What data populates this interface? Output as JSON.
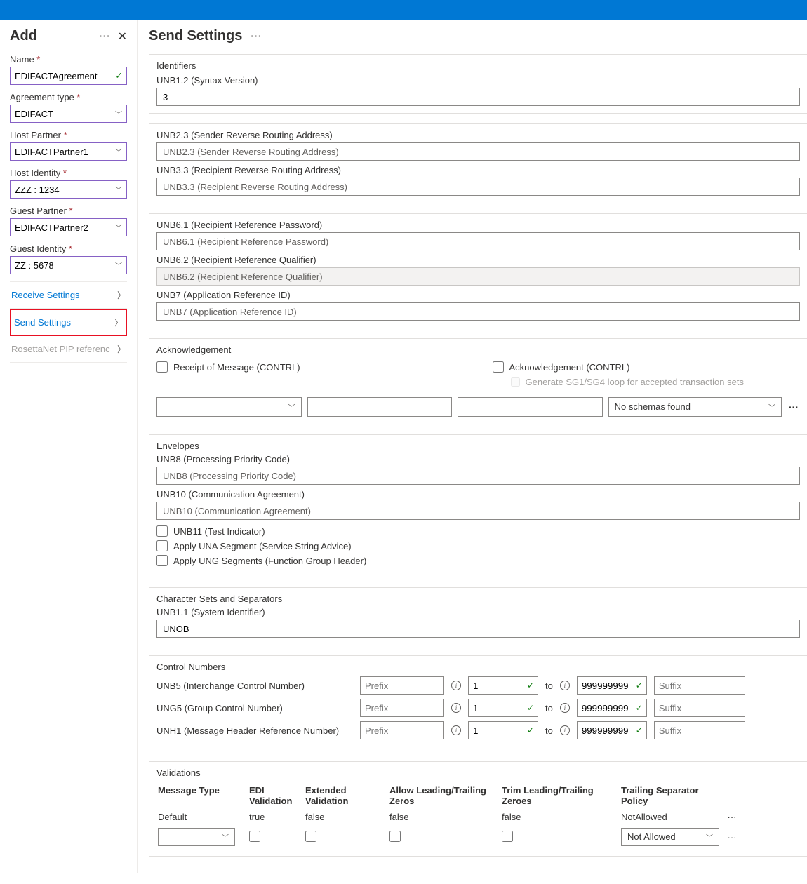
{
  "sidebar": {
    "title": "Add",
    "fields": {
      "name": {
        "label": "Name",
        "value": "EDIFACTAgreement"
      },
      "agreement_type": {
        "label": "Agreement type",
        "value": "EDIFACT"
      },
      "host_partner": {
        "label": "Host Partner",
        "value": "EDIFACTPartner1"
      },
      "host_identity": {
        "label": "Host Identity",
        "value": "ZZZ : 1234"
      },
      "guest_partner": {
        "label": "Guest Partner",
        "value": "EDIFACTPartner2"
      },
      "guest_identity": {
        "label": "Guest Identity",
        "value": "ZZ : 5678"
      }
    },
    "nav": {
      "receive": "Receive Settings",
      "send": "Send Settings",
      "rosetta": "RosettaNet PIP referenc"
    }
  },
  "main": {
    "title": "Send Settings",
    "identifiers": {
      "title": "Identifiers",
      "unb12_label": "UNB1.2 (Syntax Version)",
      "unb12_value": "3",
      "unb23_label": "UNB2.3 (Sender Reverse Routing Address)",
      "unb23_ph": "UNB2.3 (Sender Reverse Routing Address)",
      "unb33_label": "UNB3.3 (Recipient Reverse Routing Address)",
      "unb33_ph": "UNB3.3 (Recipient Reverse Routing Address)",
      "unb61_label": "UNB6.1 (Recipient Reference Password)",
      "unb61_ph": "UNB6.1 (Recipient Reference Password)",
      "unb62_label": "UNB6.2 (Recipient Reference Qualifier)",
      "unb62_ph": "UNB6.2 (Recipient Reference Qualifier)",
      "unb7_label": "UNB7 (Application Reference ID)",
      "unb7_ph": "UNB7 (Application Reference ID)"
    },
    "ack": {
      "title": "Acknowledgement",
      "receipt": "Receipt of Message (CONTRL)",
      "ack_control": "Acknowledgement (CONTRL)",
      "generate": "Generate SG1/SG4 loop for accepted transaction sets",
      "no_schema": "No schemas found"
    },
    "env": {
      "title": "Envelopes",
      "unb8_label": "UNB8 (Processing Priority Code)",
      "unb8_ph": "UNB8 (Processing Priority Code)",
      "unb10_label": "UNB10 (Communication Agreement)",
      "unb10_ph": "UNB10 (Communication Agreement)",
      "unb11": "UNB11 (Test Indicator)",
      "una": "Apply UNA Segment (Service String Advice)",
      "ung": "Apply UNG Segments (Function Group Header)"
    },
    "charset": {
      "title": "Character Sets and Separators",
      "unb11_label": "UNB1.1 (System Identifier)",
      "unb11_value": "UNOB"
    },
    "cn": {
      "title": "Control Numbers",
      "prefix_ph": "Prefix",
      "suffix_ph": "Suffix",
      "to": "to",
      "rows": [
        {
          "label": "UNB5 (Interchange Control Number)",
          "from": "1",
          "to": "999999999"
        },
        {
          "label": "UNG5 (Group Control Number)",
          "from": "1",
          "to": "999999999"
        },
        {
          "label": "UNH1 (Message Header Reference Number)",
          "from": "1",
          "to": "999999999"
        }
      ]
    },
    "val": {
      "title": "Validations",
      "headers": [
        "Message Type",
        "EDI Validation",
        "Extended Validation",
        "Allow Leading/Trailing Zeros",
        "Trim Leading/Trailing Zeroes",
        "Trailing Separator Policy"
      ],
      "default_row": {
        "type": "Default",
        "edi": "true",
        "ext": "false",
        "allow": "false",
        "trim": "false",
        "policy": "NotAllowed"
      },
      "not_allowed": "Not Allowed"
    }
  }
}
